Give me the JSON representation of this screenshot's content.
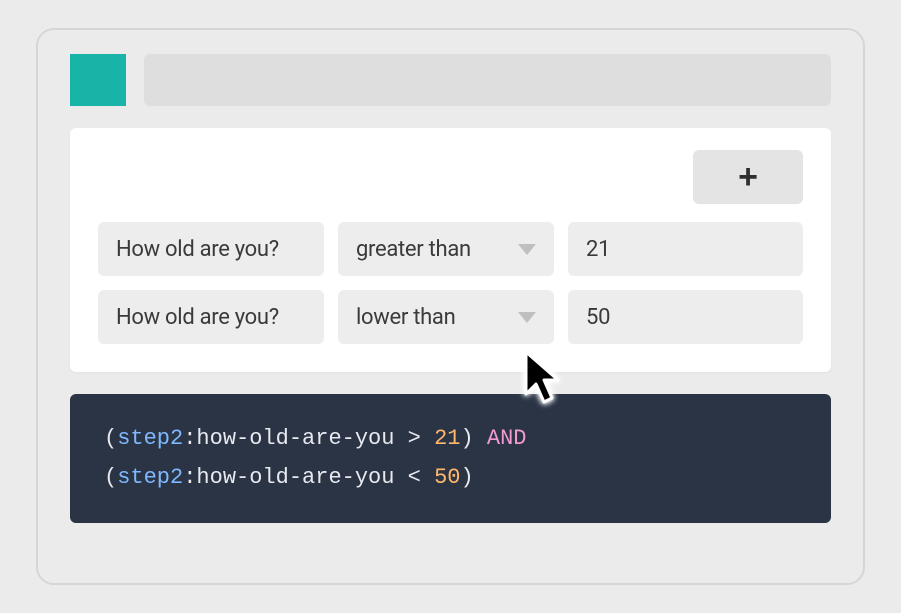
{
  "header": {
    "swatch_color": "#17b4a7"
  },
  "conditions": {
    "add_glyph": "+",
    "rows": [
      {
        "field": "How old are you?",
        "operator": "greater than",
        "value": "21"
      },
      {
        "field": "How old are you?",
        "operator": "lower than",
        "value": "50"
      }
    ]
  },
  "code": {
    "line1": {
      "open": "(",
      "step": "step2",
      "colon": ":",
      "slug": "how-old-are-you",
      "op": " > ",
      "num": "21",
      "close": ")",
      "and": " AND"
    },
    "line2": {
      "open": "(",
      "step": "step2",
      "colon": ":",
      "slug": "how-old-are-you",
      "op": " < ",
      "num": "50",
      "close": ")"
    }
  }
}
